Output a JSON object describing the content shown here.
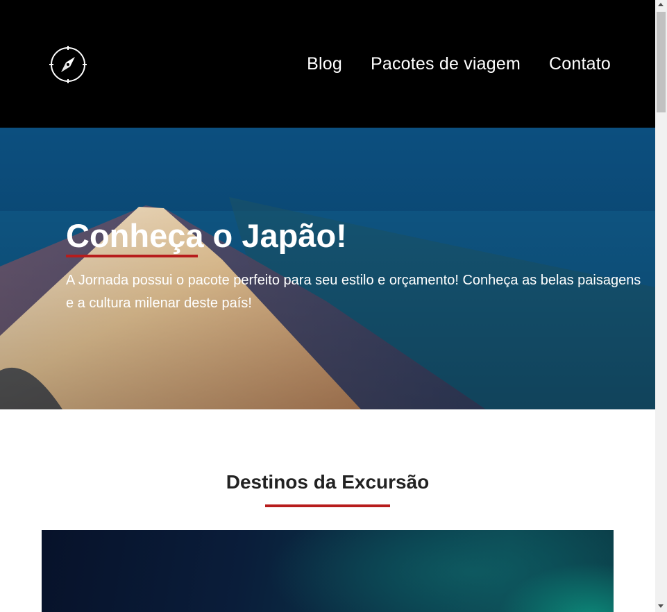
{
  "header": {
    "logo_icon": "compass-icon",
    "nav": [
      {
        "label": "Blog"
      },
      {
        "label": "Pacotes de viagem"
      },
      {
        "label": "Contato"
      }
    ]
  },
  "hero": {
    "title": "Conheça o Japão!",
    "text": "A Jornada possui o pacote perfeito para seu estilo e orçamento! Conheça as belas paisagens e a cultura milenar deste país!",
    "background": "mount-fuji-aerial-photo"
  },
  "section": {
    "title": "Destinos da Excursão",
    "image": "destination-photo"
  },
  "colors": {
    "header_bg": "#000000",
    "accent": "#b71c1c",
    "heading_text": "#222222"
  }
}
